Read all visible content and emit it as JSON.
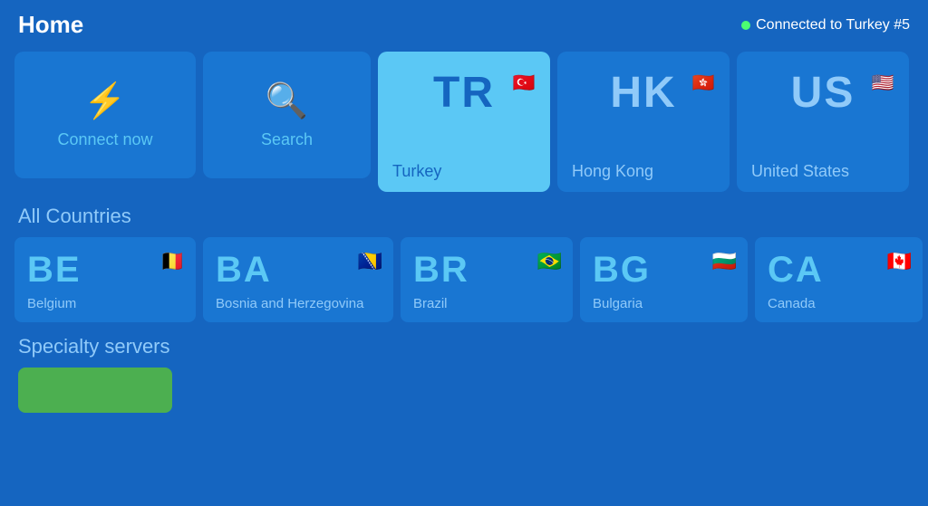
{
  "header": {
    "home_label": "Home",
    "connected_text": "Connected to Turkey #5",
    "dot_color": "#4cff72"
  },
  "tiles": [
    {
      "id": "connect-now",
      "label": "Connect now",
      "icon": "⚡",
      "type": "action"
    },
    {
      "id": "search",
      "label": "Search",
      "icon": "🔍",
      "type": "action"
    },
    {
      "id": "turkey",
      "code": "TR",
      "name": "Turkey",
      "flag": "🇹🇷",
      "active": true
    },
    {
      "id": "hong-kong",
      "code": "HK",
      "name": "Hong Kong",
      "flag": "🇭🇰",
      "active": false
    },
    {
      "id": "united-states",
      "code": "US",
      "name": "United States",
      "flag": "🇺🇸",
      "active": false
    }
  ],
  "all_countries_label": "All Countries",
  "countries": [
    {
      "code": "BE",
      "name": "Belgium",
      "flag": "🇧🇪"
    },
    {
      "code": "BA",
      "name": "Bosnia and Herzegovina",
      "flag": "🇧🇦"
    },
    {
      "code": "BR",
      "name": "Brazil",
      "flag": "🇧🇷"
    },
    {
      "code": "BG",
      "name": "Bulgaria",
      "flag": "🇧🇬"
    },
    {
      "code": "CA",
      "name": "Canada",
      "flag": "🇨🇦"
    }
  ],
  "specialty_servers_label": "Specialty servers"
}
